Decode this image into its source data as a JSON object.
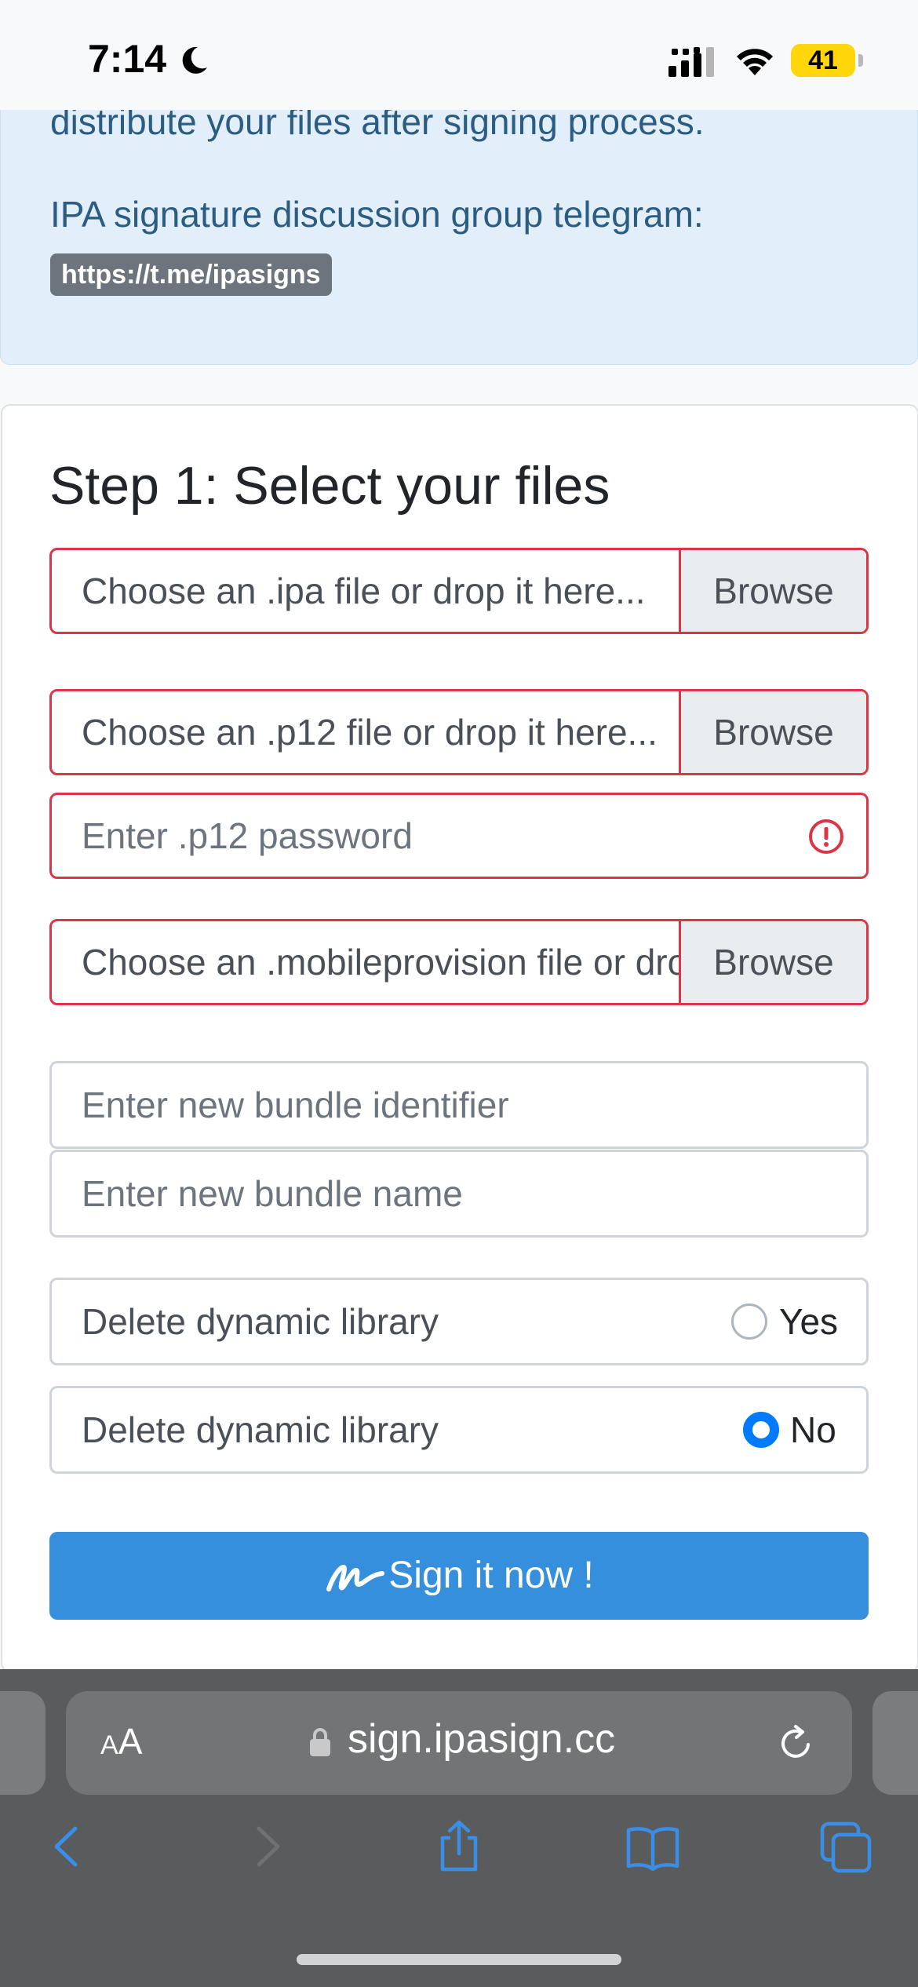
{
  "status_bar": {
    "time": "7:14",
    "battery": "41"
  },
  "alert": {
    "line1": "distribute your files after signing process.",
    "line2": "IPA signature discussion group telegram:",
    "link": "https://t.me/ipasigns"
  },
  "card": {
    "title": "Step 1: Select your files",
    "ipa_placeholder": "Choose an .ipa file or drop it here...",
    "p12_placeholder": "Choose an .p12 file or drop it here...",
    "password_placeholder": "Enter .p12 password",
    "mobileprovision_placeholder": "Choose an .mobileprovision file or drop it here...",
    "browse_label": "Browse",
    "bundle_id_placeholder": "Enter new bundle identifier",
    "bundle_name_placeholder": "Enter new bundle name",
    "option_yes_label": "Delete dynamic library",
    "yes": "Yes",
    "option_no_label": "Delete dynamic library",
    "no": "No",
    "selected": "No",
    "sign_button": "Sign it now !"
  },
  "browser": {
    "text_size_small": "A",
    "text_size_big": "A",
    "url": "sign.ipasign.cc"
  },
  "colors": {
    "accent": "#368fdd",
    "error": "#dc3545",
    "radio_active": "#007bff",
    "alert_bg": "#e2effa"
  },
  "icons": [
    "moon-icon",
    "cellular-signal-icon",
    "wifi-icon",
    "battery-icon",
    "error-icon",
    "signature-icon",
    "lock-icon",
    "reload-icon",
    "back-icon",
    "forward-icon",
    "share-icon",
    "bookmarks-icon",
    "tabs-icon"
  ]
}
